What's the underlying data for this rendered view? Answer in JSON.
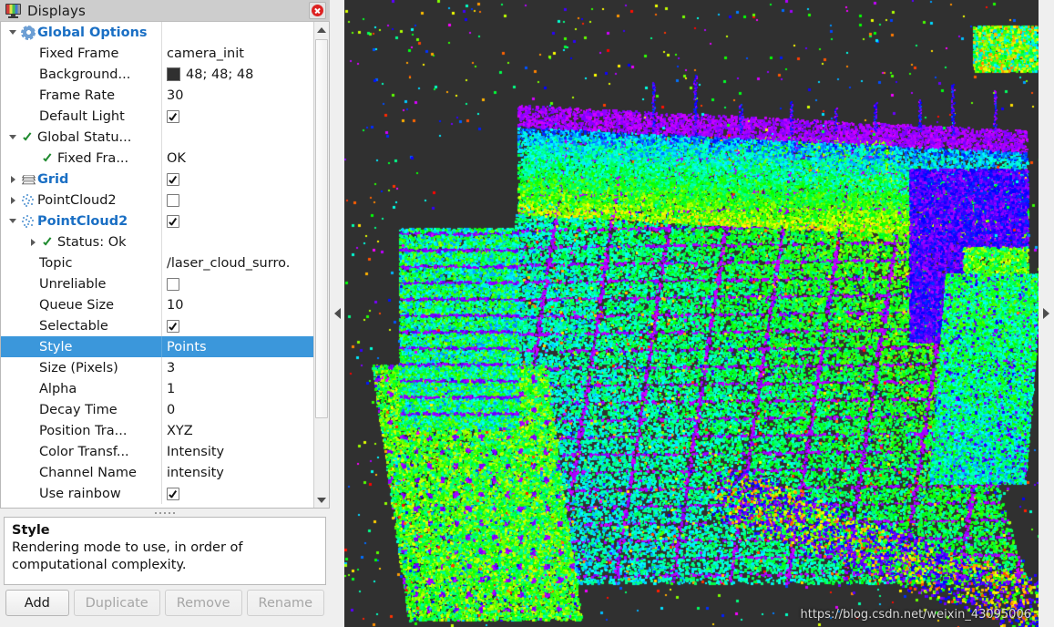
{
  "panel": {
    "title": "Displays",
    "icon": "monitor-icon",
    "close_icon": "close-icon"
  },
  "tree": {
    "rows": [
      {
        "name": "Global Options",
        "value": "",
        "indent": 0,
        "arrow": "down",
        "icon": "gear-icon",
        "style": "bold-blue",
        "value_type": "none"
      },
      {
        "name": "Fixed Frame",
        "value": "camera_init",
        "indent": 1,
        "arrow": "none",
        "icon": "none",
        "style": "plain",
        "value_type": "text"
      },
      {
        "name": "Background...",
        "value": "48; 48; 48",
        "indent": 1,
        "arrow": "none",
        "icon": "none",
        "style": "plain",
        "value_type": "color",
        "swatch": "#303030"
      },
      {
        "name": "Frame Rate",
        "value": "30",
        "indent": 1,
        "arrow": "none",
        "icon": "none",
        "style": "plain",
        "value_type": "text"
      },
      {
        "name": "Default Light",
        "value": "",
        "indent": 1,
        "arrow": "none",
        "icon": "none",
        "style": "plain",
        "value_type": "checkbox-on"
      },
      {
        "name": "Global Statu...",
        "value": "",
        "indent": 0,
        "arrow": "down",
        "icon": "green-check-icon",
        "style": "plain",
        "value_type": "none"
      },
      {
        "name": "Fixed Fra...",
        "value": "OK",
        "indent": 1,
        "arrow": "none",
        "icon": "green-check-icon",
        "style": "plain",
        "value_type": "text"
      },
      {
        "name": "Grid",
        "value": "",
        "indent": 0,
        "arrow": "right",
        "icon": "grid-icon",
        "style": "bold-blue",
        "value_type": "checkbox-on"
      },
      {
        "name": "PointCloud2",
        "value": "",
        "indent": 0,
        "arrow": "right",
        "icon": "pointcloud-icon",
        "style": "plain",
        "value_type": "checkbox-off"
      },
      {
        "name": "PointCloud2",
        "value": "",
        "indent": 0,
        "arrow": "down",
        "icon": "pointcloud-icon",
        "style": "bold-blue",
        "value_type": "checkbox-on"
      },
      {
        "name": "Status: Ok",
        "value": "",
        "indent": 1,
        "arrow": "right",
        "icon": "green-check-icon",
        "style": "plain",
        "value_type": "none"
      },
      {
        "name": "Topic",
        "value": "/laser_cloud_surro.",
        "indent": 1,
        "arrow": "none",
        "icon": "none",
        "style": "plain",
        "value_type": "text"
      },
      {
        "name": "Unreliable",
        "value": "",
        "indent": 1,
        "arrow": "none",
        "icon": "none",
        "style": "plain",
        "value_type": "checkbox-off"
      },
      {
        "name": "Queue Size",
        "value": "10",
        "indent": 1,
        "arrow": "none",
        "icon": "none",
        "style": "plain",
        "value_type": "text"
      },
      {
        "name": "Selectable",
        "value": "",
        "indent": 1,
        "arrow": "none",
        "icon": "none",
        "style": "plain",
        "value_type": "checkbox-on"
      },
      {
        "name": "Style",
        "value": "Points",
        "indent": 1,
        "arrow": "none",
        "icon": "none",
        "style": "plain",
        "value_type": "text",
        "selected": true
      },
      {
        "name": "Size (Pixels)",
        "value": "3",
        "indent": 1,
        "arrow": "none",
        "icon": "none",
        "style": "plain",
        "value_type": "text"
      },
      {
        "name": "Alpha",
        "value": "1",
        "indent": 1,
        "arrow": "none",
        "icon": "none",
        "style": "plain",
        "value_type": "text"
      },
      {
        "name": "Decay Time",
        "value": "0",
        "indent": 1,
        "arrow": "none",
        "icon": "none",
        "style": "plain",
        "value_type": "text"
      },
      {
        "name": "Position Tra...",
        "value": "XYZ",
        "indent": 1,
        "arrow": "none",
        "icon": "none",
        "style": "plain",
        "value_type": "text"
      },
      {
        "name": "Color Transf...",
        "value": "Intensity",
        "indent": 1,
        "arrow": "none",
        "icon": "none",
        "style": "plain",
        "value_type": "text"
      },
      {
        "name": "Channel Name",
        "value": "intensity",
        "indent": 1,
        "arrow": "none",
        "icon": "none",
        "style": "plain",
        "value_type": "text"
      },
      {
        "name": "Use rainbow",
        "value": "",
        "indent": 1,
        "arrow": "none",
        "icon": "none",
        "style": "plain",
        "value_type": "checkbox-on"
      }
    ]
  },
  "description": {
    "title": "Style",
    "body": "Rendering mode to use, in order of computational complexity."
  },
  "buttons": {
    "add": "Add",
    "duplicate": "Duplicate",
    "remove": "Remove",
    "rename": "Rename"
  },
  "view3d": {
    "background_color": "#303030",
    "watermark": "https://blog.csdn.net/weixin_43095006"
  }
}
